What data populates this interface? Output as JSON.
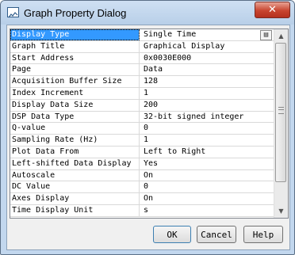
{
  "window": {
    "title": "Graph Property Dialog",
    "close_label": "✕"
  },
  "properties": [
    {
      "name": "Display Type",
      "value": "Single Time"
    },
    {
      "name": "Graph Title",
      "value": "Graphical Display"
    },
    {
      "name": "Start Address",
      "value": "0x0030E000"
    },
    {
      "name": "Page",
      "value": "Data"
    },
    {
      "name": "Acquisition Buffer Size",
      "value": "128"
    },
    {
      "name": "Index Increment",
      "value": "1"
    },
    {
      "name": "Display Data Size",
      "value": "200"
    },
    {
      "name": "DSP Data Type",
      "value": "32-bit signed integer"
    },
    {
      "name": "Q-value",
      "value": "0"
    },
    {
      "name": "Sampling Rate (Hz)",
      "value": "1"
    },
    {
      "name": "Plot Data From",
      "value": "Left to Right"
    },
    {
      "name": "Left-shifted Data Display",
      "value": "Yes"
    },
    {
      "name": "Autoscale",
      "value": "On"
    },
    {
      "name": "DC Value",
      "value": "0"
    },
    {
      "name": "Axes Display",
      "value": "On"
    },
    {
      "name": "Time Display Unit",
      "value": "s"
    }
  ],
  "selected_row": 0,
  "buttons": {
    "ok": "OK",
    "cancel": "Cancel",
    "help": "Help"
  }
}
